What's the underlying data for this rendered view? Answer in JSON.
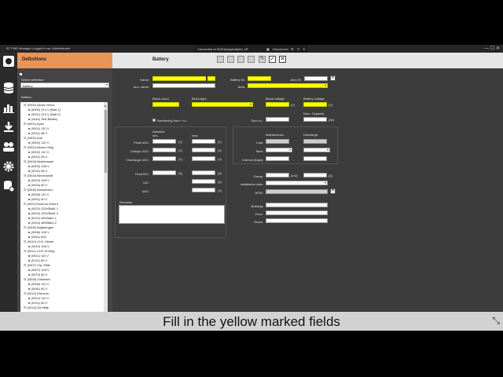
{
  "window": {
    "title": "BT PMD Manager    Logged in as: Administrator"
  },
  "connection": {
    "status": "Connected to MSDisplayAdapter_0F",
    "disconnect_label": "Disconnect"
  },
  "left": {
    "header": "Definitions",
    "select_label": "Select definition:",
    "select_value": "Battery",
    "battery_label": "Battery:",
    "tree": [
      {
        "t": "(0000) Alpha Venus",
        "lvl": 0
      },
      {
        "t": "(0000) 214 V (Batt.1)",
        "lvl": 1
      },
      {
        "t": "(0001) 214 V (Batt.2)",
        "lvl": 1
      },
      {
        "t": "(4444) Test Battery",
        "lvl": 1
      },
      {
        "t": "(0001) Apen",
        "lvl": 0
      },
      {
        "t": "(0001) 110 V",
        "lvl": 1
      },
      {
        "t": "(0011) 48 V",
        "lvl": 1
      },
      {
        "t": "(0002) Arle",
        "lvl": 0
      },
      {
        "t": "(0000) 110 V",
        "lvl": 1
      },
      {
        "t": "(0002) Benter Weg",
        "lvl": 0
      },
      {
        "t": "(0002) 110 V",
        "lvl": 1
      },
      {
        "t": "(0021) 48 V",
        "lvl": 1
      },
      {
        "t": "(0003) Bedekaspel",
        "lvl": 0
      },
      {
        "t": "(0003) 108 V",
        "lvl": 1
      },
      {
        "t": "(0031) 56 V",
        "lvl": 1
      },
      {
        "t": "(0004) Bevenstedt",
        "lvl": 0
      },
      {
        "t": "(0003) 108 V",
        "lvl": 1
      },
      {
        "t": "(0004) 60 V",
        "lvl": 1
      },
      {
        "t": "(0005) Bollwerden",
        "lvl": 0
      },
      {
        "t": "(0005) 110 V",
        "lvl": 1
      },
      {
        "t": "(0051) 60 V",
        "lvl": 1
      },
      {
        "t": "(0022) Borkum West II",
        "lvl": 0
      },
      {
        "t": "(0022) 220VBatt1.1",
        "lvl": 1
      },
      {
        "t": "(0023) 220VBatt1.2",
        "lvl": 1
      },
      {
        "t": "(0022) 48VBatt1.1",
        "lvl": 1
      },
      {
        "t": "(0023) 48VBatt1.2",
        "lvl": 1
      },
      {
        "t": "(0006) Butjadingen",
        "lvl": 0
      },
      {
        "t": "(0006) 108 V",
        "lvl": 1
      },
      {
        "t": "(0061) 60V",
        "lvl": 1
      },
      {
        "t": "(0010) CUX Osteel",
        "lvl": 0
      },
      {
        "t": "(0010) 108 V",
        "lvl": 1
      },
      {
        "t": "(0011) CUX St.Weg",
        "lvl": 0
      },
      {
        "t": "(0011) 110 V",
        "lvl": 1
      },
      {
        "t": "(0112) 60 V",
        "lvl": 1
      },
      {
        "t": "(0007) Clp. Mitte",
        "lvl": 0
      },
      {
        "t": "(0007) 108 V",
        "lvl": 1
      },
      {
        "t": "(0070) 60 V",
        "lvl": 1
      },
      {
        "t": "(0008) Coldewei",
        "lvl": 0
      },
      {
        "t": "(0008) 110 V",
        "lvl": 1
      },
      {
        "t": "(0081) 60 V",
        "lvl": 1
      },
      {
        "t": "(0012) Diersum",
        "lvl": 0
      },
      {
        "t": "(0012) 110 V",
        "lvl": 1
      },
      {
        "t": "(0121) 60 V",
        "lvl": 1
      },
      {
        "t": "(0013) Dd Mitte",
        "lvl": 0
      }
    ]
  },
  "detail": {
    "header": "Battery",
    "name_label": "Name:",
    "aux_name_label": "Aux. name:",
    "battery_id_label": "Battery ID:",
    "area_label": "Area:",
    "area_id_label": "Area ID:",
    "block_count_label": "Block count",
    "block_type_label": "Block type:",
    "block_voltage_label": "Block voltage",
    "battery_voltage_label": "Battery voltage",
    "unit_v": "[V]",
    "unit_a": "[A]",
    "unit_ah": "[Ah]",
    "unit_mohm": "[mΩ]",
    "tour_label": "Tour-nu.:",
    "nom_capacity_label": "Nom. Capacity",
    "numbering_label": "Numbering from + to -",
    "absolute_label": "Absolute",
    "min_label": "min.",
    "max_label": "max.",
    "float_udc_label": "Float UDC:",
    "charge_udc_label": "Charge UDC:",
    "discharge_udc_label": "Discharge UDC:",
    "float_idc_label": "Float IDC:",
    "iac_label": "IAC:",
    "uac_label": "UAC:",
    "maintenance_label": "Maintenance:",
    "discharge_label": "Discharge:",
    "last_label": "Last:",
    "next_label": "Next:",
    "interval_label": "Interval [Days]:",
    "clamp_label": "Clamp:",
    "installation_date_label": "Installation date:",
    "rfid_label": "RFID:",
    "remarks_label": "Remarks:",
    "building_label": "Building:",
    "floor_label": "Floor:",
    "room_label": "Room:"
  },
  "caption": "Fill in the yellow marked fields"
}
